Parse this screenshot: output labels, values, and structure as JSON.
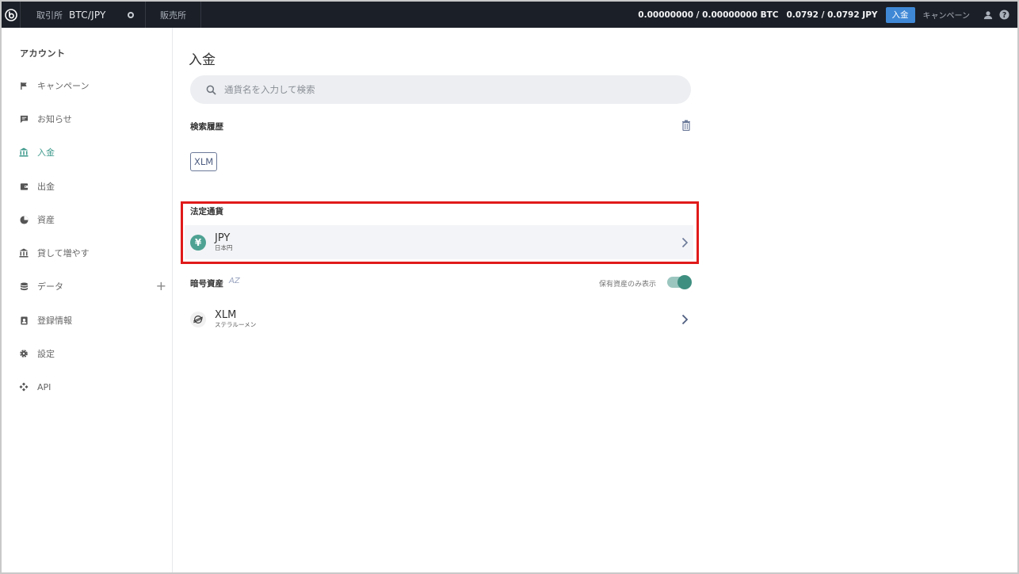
{
  "topbar": {
    "exchange_label": "取引所",
    "pair": "BTC/JPY",
    "sales_label": "販売所",
    "balance_btc": "0.00000000 / 0.00000000 BTC",
    "balance_jpy": "0.0792 / 0.0792 JPY",
    "deposit_button": "入金",
    "campaign": "キャンペーン"
  },
  "sidebar": {
    "title": "アカウント",
    "items": [
      {
        "label": "キャンペーン",
        "icon": "flag-icon"
      },
      {
        "label": "お知らせ",
        "icon": "message-icon"
      },
      {
        "label": "入金",
        "icon": "bank-icon",
        "active": true
      },
      {
        "label": "出金",
        "icon": "wallet-icon"
      },
      {
        "label": "資産",
        "icon": "pie-chart-icon"
      },
      {
        "label": "貸して増やす",
        "icon": "bank-icon"
      },
      {
        "label": "データ",
        "icon": "database-icon"
      },
      {
        "label": "登録情報",
        "icon": "id-card-icon"
      },
      {
        "label": "設定",
        "icon": "gear-icon"
      },
      {
        "label": "API",
        "icon": "api-icon"
      }
    ],
    "data_plus": "+"
  },
  "main": {
    "title": "入金",
    "search": {
      "placeholder": "通貨名を入力して検索"
    },
    "history": {
      "label": "検索履歴",
      "chips": [
        "XLM"
      ]
    },
    "fiat": {
      "label": "法定通貨",
      "items": [
        {
          "symbol": "JPY",
          "name": "日本円",
          "icon_glyph": "¥"
        }
      ]
    },
    "crypto": {
      "label": "暗号資産",
      "sort_label": "AZ",
      "toggle_label": "保有資産のみ表示",
      "toggle_on": true,
      "items": [
        {
          "symbol": "XLM",
          "name": "ステラルーメン"
        }
      ]
    }
  },
  "colors": {
    "topbar_bg": "#1b1f27",
    "accent": "#3f9a8c",
    "deposit_button": "#3f88d6",
    "highlight": "#e01a1a"
  }
}
